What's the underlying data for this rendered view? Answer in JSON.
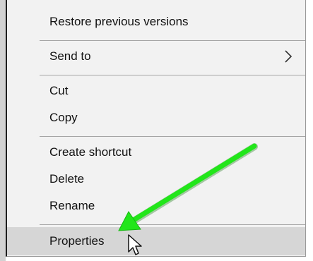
{
  "menu": {
    "items": [
      {
        "label": "Restore previous versions"
      },
      {
        "label": "Send to"
      },
      {
        "label": "Cut"
      },
      {
        "label": "Copy"
      },
      {
        "label": "Create shortcut"
      },
      {
        "label": "Delete"
      },
      {
        "label": "Rename"
      },
      {
        "label": "Properties"
      }
    ],
    "submenu_icon": "chevron-right-icon",
    "hovered_item": "Properties"
  },
  "annotation": {
    "arrow_color": "#22e61a",
    "arrow_target": "Properties"
  },
  "cursor": {
    "icon": "arrow-pointer-icon"
  }
}
